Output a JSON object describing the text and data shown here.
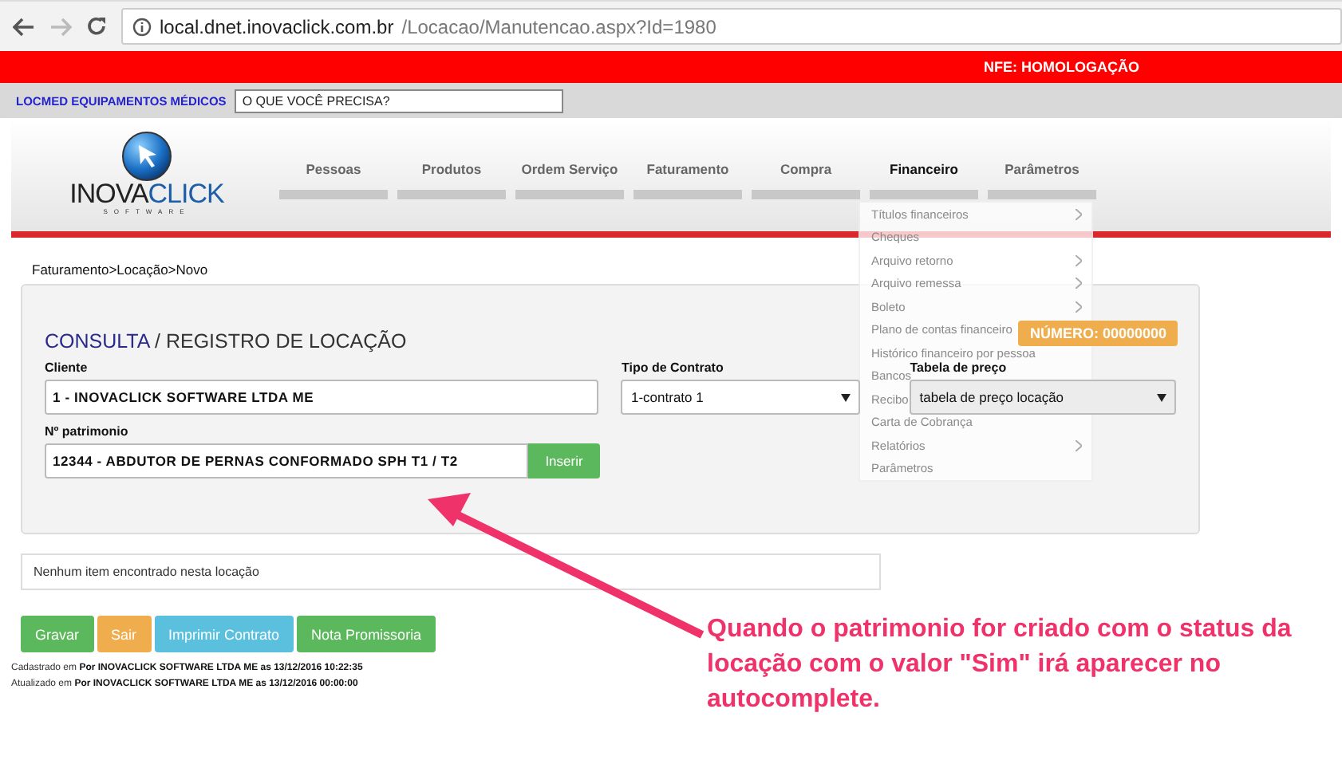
{
  "browser": {
    "url_host": "local.dnet.inovaclick.com.br",
    "url_path": "/Locacao/Manutencao.aspx?Id=1980"
  },
  "top_bar": {
    "environment": "NFE: HOMOLOGAÇÃO"
  },
  "company_bar": {
    "company": "LOCMED EQUIPAMENTOS MÉDICOS",
    "search_placeholder": "O QUE VOCÊ PRECISA?"
  },
  "logo": {
    "name_a": "INOVA",
    "name_b": "CLICK",
    "tagline": "SOFTWARE"
  },
  "nav": [
    {
      "label": "Pessoas",
      "selected": false
    },
    {
      "label": "Produtos",
      "selected": false
    },
    {
      "label": "Ordem Serviço",
      "selected": false
    },
    {
      "label": "Faturamento",
      "selected": false
    },
    {
      "label": "Compra",
      "selected": false
    },
    {
      "label": "Financeiro",
      "selected": true
    },
    {
      "label": "Parâmetros",
      "selected": false
    }
  ],
  "financeiro_menu": [
    {
      "label": "Títulos financeiros",
      "submenu": true
    },
    {
      "label": "Cheques",
      "submenu": false
    },
    {
      "label": "Arquivo retorno",
      "submenu": true
    },
    {
      "label": "Arquivo remessa",
      "submenu": true
    },
    {
      "label": "Boleto",
      "submenu": true
    },
    {
      "label": "Plano de contas financeiro",
      "submenu": false
    },
    {
      "label": "Histórico financeiro por pessoa",
      "submenu": false
    },
    {
      "label": "Bancos",
      "submenu": false
    },
    {
      "label": "Recibo",
      "submenu": false
    },
    {
      "label": "Carta de Cobrança",
      "submenu": false
    },
    {
      "label": "Relatórios",
      "submenu": true
    },
    {
      "label": "Parâmetros",
      "submenu": false
    }
  ],
  "breadcrumb": "Faturamento>Locação>Novo",
  "form": {
    "title_a": "CONSULTA",
    "title_b": "/ REGISTRO DE LOCAÇÃO",
    "number_badge": "NÚMERO: 00000000",
    "cliente": {
      "label": "Cliente",
      "value": "1 - INOVACLICK SOFTWARE LTDA ME"
    },
    "tipo_contrato": {
      "label": "Tipo de Contrato",
      "value": "1-contrato 1"
    },
    "tabela_preco": {
      "label": "Tabela de preço",
      "value": "tabela de preço locação"
    },
    "patrimonio": {
      "label": "Nº patrimonio",
      "value": "12344 - ABDUTOR DE PERNAS CONFORMADO SPH T1 / T2",
      "button": "Inserir"
    }
  },
  "items_message": "Nenhum item encontrado nesta locação",
  "buttons": [
    {
      "label": "Gravar",
      "kind": "success"
    },
    {
      "label": "Sair",
      "kind": "warning"
    },
    {
      "label": "Imprimir Contrato",
      "kind": "info"
    },
    {
      "label": "Nota Promissoria",
      "kind": "success"
    }
  ],
  "audit": [
    {
      "prefix": "Cadastrado em",
      "text": "Por INOVACLICK SOFTWARE LTDA ME as 13/12/2016 10:22:35"
    },
    {
      "prefix": "Atualizado em",
      "text": "Por INOVACLICK SOFTWARE LTDA ME as 13/12/2016 00:00:00"
    }
  ],
  "annotation": "Quando o patrimonio for criado com o status da locação com o valor \"Sim\" irá aparecer no autocomplete."
}
